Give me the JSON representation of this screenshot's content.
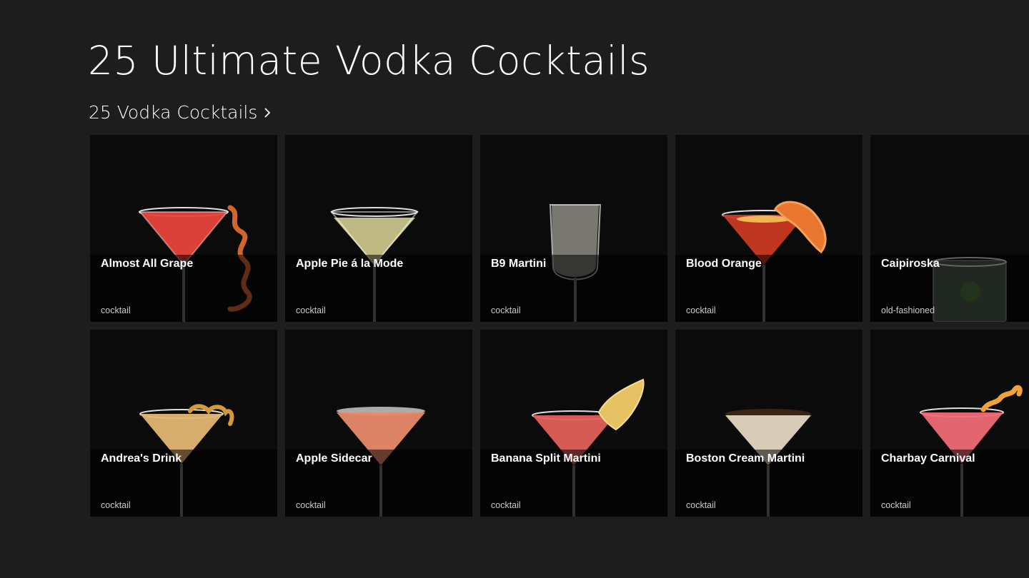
{
  "app": {
    "title": "25 Ultimate Vodka Cocktails"
  },
  "group": {
    "header": "25 Vodka Cocktails",
    "chevron_icon": "chevron-right-icon"
  },
  "colors": {
    "background": "#1d1d1d",
    "tile_background": "#0b0b0b",
    "text": "#ffffff",
    "subtext": "#c8c8c8"
  },
  "tiles": [
    {
      "name": "Almost All Grape",
      "type": "cocktail",
      "glass": "martini",
      "liquid": "#e8453c",
      "garnish": "orange-peel-spiral"
    },
    {
      "name": "Apple Pie á la Mode",
      "type": "cocktail",
      "glass": "martini",
      "liquid": "#c9c48a",
      "garnish": "none"
    },
    {
      "name": "B9 Martini",
      "type": "cocktail",
      "glass": "flute",
      "liquid": "#8c8c84",
      "garnish": "none"
    },
    {
      "name": "Blood Orange",
      "type": "cocktail",
      "glass": "martini",
      "liquid": "#c93a22",
      "garnish": "orange-slice"
    },
    {
      "name": "Caipiroska",
      "type": "old-fashioned",
      "glass": "old-fashioned",
      "liquid": "#6c7a6a",
      "garnish": "lime"
    },
    {
      "name": "Andrea's Drink",
      "type": "cocktail",
      "glass": "martini",
      "liquid": "#e3b673",
      "garnish": "orange-twist"
    },
    {
      "name": "Apple Sidecar",
      "type": "cocktail",
      "glass": "martini",
      "liquid": "#e98a6a",
      "garnish": "sugar-rim"
    },
    {
      "name": "Banana Split Martini",
      "type": "cocktail",
      "glass": "martini",
      "liquid": "#e2605c",
      "garnish": "banana-chip"
    },
    {
      "name": "Boston Cream Martini",
      "type": "cocktail",
      "glass": "martini",
      "liquid": "#e4d6c1",
      "garnish": "chocolate-rim"
    },
    {
      "name": "Charbay Carnival",
      "type": "cocktail",
      "glass": "martini",
      "liquid": "#ef6a76",
      "garnish": "orange-twist"
    }
  ]
}
